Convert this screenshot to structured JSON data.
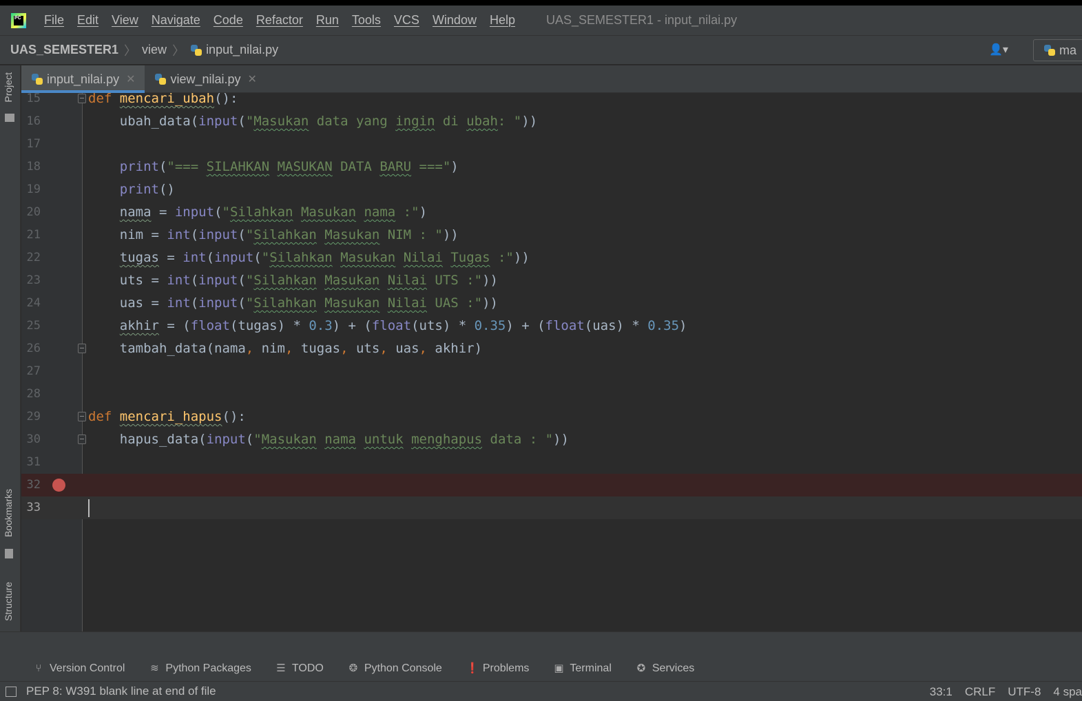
{
  "menubar": {
    "items": [
      "File",
      "Edit",
      "View",
      "Navigate",
      "Code",
      "Refactor",
      "Run",
      "Tools",
      "VCS",
      "Window",
      "Help"
    ],
    "window_title": "UAS_SEMESTER1 - input_nilai.py"
  },
  "navbar": {
    "project": "UAS_SEMESTER1",
    "folder": "view",
    "file": "input_nilai.py",
    "run_config": "ma"
  },
  "sidebar": {
    "project": "Project",
    "bookmarks": "Bookmarks",
    "structure": "Structure"
  },
  "tabs": [
    {
      "label": "input_nilai.py",
      "active": true
    },
    {
      "label": "view_nilai.py",
      "active": false
    }
  ],
  "editor": {
    "line_numbers": [
      "15",
      "16",
      "17",
      "18",
      "19",
      "20",
      "21",
      "22",
      "23",
      "24",
      "25",
      "26",
      "27",
      "28",
      "29",
      "30",
      "31",
      "32",
      "33"
    ],
    "breakpoint_line": "32",
    "current_line": "33"
  },
  "tool_windows": [
    "Version Control",
    "Python Packages",
    "TODO",
    "Python Console",
    "Problems",
    "Terminal",
    "Services"
  ],
  "statusbar": {
    "message": "PEP 8: W391 blank line at end of file",
    "position": "33:1",
    "line_separator": "CRLF",
    "encoding": "UTF-8",
    "indent": "4 spa"
  },
  "colors": {
    "keyword": "#cc7832",
    "function": "#ffc66d",
    "string": "#6a8759",
    "builtin": "#8888c6",
    "number": "#6897bb",
    "breakpoint": "#c75450",
    "accent": "#4a88c7"
  }
}
